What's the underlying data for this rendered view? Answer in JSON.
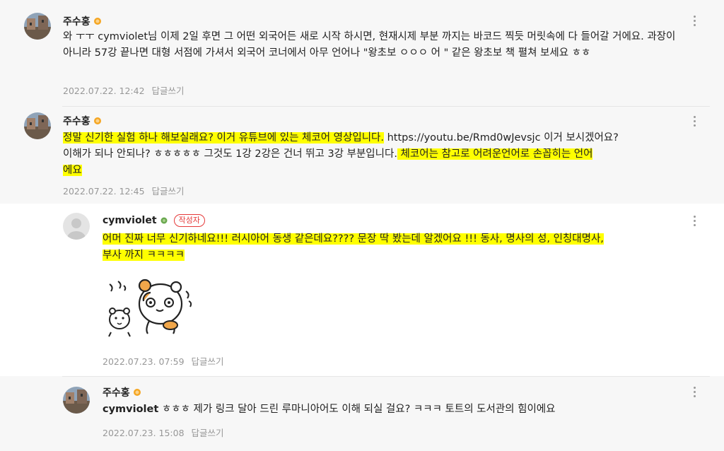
{
  "comments": [
    {
      "author": "주수홍",
      "text": "와 ㅜㅜ cymviolet님 이제 2일 후면 그 어떤 외국어든 새로 시작 하시면, 현재시제 부분 까지는 바코드 찍듯 머릿속에 다 들어갈 거에요. 과장이 아니라 57강 끝나면 대형 서점에 가셔서 외국어 코너에서 아무 언어나 \"왕초보 ㅇㅇㅇ 어 \" 같은 왕초보 책 펼쳐 보세요 ㅎㅎ",
      "date": "2022.07.22. 12:42",
      "reply": "답글쓰기"
    },
    {
      "author": "주수홍",
      "line1_hl": "정말 신기한 실험 하나 해보실래요? 이거 유튜브에 있는 체코어 영상입니다.",
      "line1_rest": " https://youtu.be/Rmd0wJevsjc 이거 보시겠어요?",
      "line2_plain": "이해가 되나 안되나? ㅎㅎㅎㅎㅎ 그것도 1강 2강은 건너 뛰고 3강 부분입니다.",
      "line2_hl": " 체코어는 참고로 어려운언어로 손꼽히는 언어",
      "line3_hl": "에요",
      "date": "2022.07.22. 12:45",
      "reply": "답글쓰기"
    },
    {
      "author": "cymviolet",
      "badge": "작성자",
      "line1_hl": "어머 진짜 너무 신기하네요!!! 러시아어 동생 같은데요???? 문장 딱 봤는데 알겠어요 !!! 동사, 명사의 성, 인칭대명사,",
      "line2_hl": "부사 까지 ㅋㅋㅋㅋ",
      "sticker": "hamster-sticker",
      "date": "2022.07.23. 07:59",
      "reply": "답글쓰기"
    },
    {
      "author": "주수홍",
      "mention": "cymviolet",
      "text": " ㅎㅎㅎ 제가 링크 달아 드린 루마니아어도 이해 되실 걸요? ㅋㅋㅋ 토트의 도서관의 힘이에요",
      "date": "2022.07.23. 15:08",
      "reply": "답글쓰기"
    }
  ],
  "colors": {
    "highlight": "#ffff00",
    "badge": "#e53939",
    "meta": "#979797",
    "medal": "#f5a623"
  },
  "icons": [
    "more-vertical-icon",
    "medal-icon",
    "avatar-photo",
    "default-avatar"
  ]
}
